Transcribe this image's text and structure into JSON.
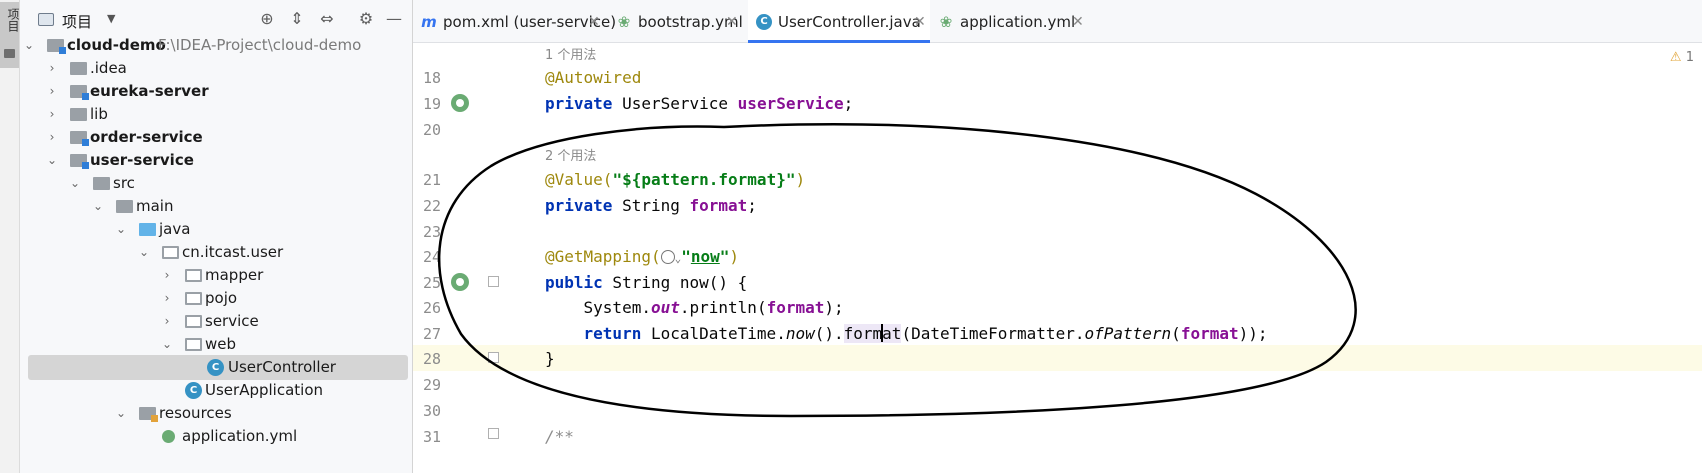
{
  "toolstrip": {
    "project_tab_label": "项目"
  },
  "project_panel": {
    "title": "项目",
    "tree": [
      {
        "label": "cloud-demo",
        "path": "F:\\IDEA-Project\\cloud-demo",
        "bold": true,
        "expanded": true,
        "icon": "module-folder-icon"
      },
      {
        "label": ".idea",
        "bold": false,
        "expanded": false,
        "icon": "folder-icon"
      },
      {
        "label": "eureka-server",
        "bold": true,
        "expanded": false,
        "icon": "module-folder-icon"
      },
      {
        "label": "lib",
        "bold": false,
        "expanded": false,
        "icon": "folder-icon"
      },
      {
        "label": "order-service",
        "bold": true,
        "expanded": false,
        "icon": "module-folder-icon"
      },
      {
        "label": "user-service",
        "bold": true,
        "expanded": true,
        "icon": "module-folder-icon"
      },
      {
        "label": "src",
        "bold": false,
        "expanded": true,
        "icon": "folder-icon"
      },
      {
        "label": "main",
        "bold": false,
        "expanded": true,
        "icon": "folder-icon"
      },
      {
        "label": "java",
        "bold": false,
        "expanded": true,
        "icon": "source-folder-icon"
      },
      {
        "label": "cn.itcast.user",
        "bold": false,
        "expanded": true,
        "icon": "package-icon"
      },
      {
        "label": "mapper",
        "bold": false,
        "expanded": false,
        "icon": "package-icon"
      },
      {
        "label": "pojo",
        "bold": false,
        "expanded": false,
        "icon": "package-icon"
      },
      {
        "label": "service",
        "bold": false,
        "expanded": false,
        "icon": "package-icon"
      },
      {
        "label": "web",
        "bold": false,
        "expanded": true,
        "icon": "package-icon"
      },
      {
        "label": "UserController",
        "bold": false,
        "selected": true,
        "icon": "java-class-icon"
      },
      {
        "label": "UserApplication",
        "bold": false,
        "icon": "spring-class-icon"
      },
      {
        "label": "resources",
        "bold": false,
        "expanded": true,
        "icon": "resources-folder-icon"
      },
      {
        "label": "application.yml",
        "bold": false,
        "icon": "yaml-file-icon"
      }
    ]
  },
  "tabs": [
    {
      "label": "pom.xml (user-service)",
      "icon": "maven-icon",
      "icon_glyph": "m",
      "active": false
    },
    {
      "label": "bootstrap.yml",
      "icon": "spring-yaml-icon",
      "icon_glyph": "❀",
      "active": false
    },
    {
      "label": "UserController.java",
      "icon": "java-class-icon",
      "icon_glyph": "C",
      "active": true
    },
    {
      "label": "application.yml",
      "icon": "spring-yaml-icon",
      "icon_glyph": "❀",
      "active": false
    }
  ],
  "editor": {
    "warning_count": "1",
    "usages_1": "1 个用法",
    "usages_2": "2 个用法",
    "lines": {
      "18": "18",
      "19": "19",
      "20": "20",
      "21": "21",
      "22": "22",
      "23": "23",
      "24": "24",
      "25": "25",
      "26": "26",
      "27": "27",
      "28": "28",
      "29": "29",
      "30": "30",
      "31": "31"
    },
    "code": {
      "l18_ann": "@Autowired",
      "l19_kw": "private",
      "l19_type": " UserService ",
      "l19_field": "userService",
      "l19_end": ";",
      "l21_ann": "@Value(",
      "l21_str": "\"${pattern.format}\"",
      "l21_end": ")",
      "l22_kw": "private",
      "l22_type": " String ",
      "l22_field": "format",
      "l22_end": ";",
      "l24_ann": "@GetMapping(",
      "l24_q1": "\"",
      "l24_str": "now",
      "l24_q2": "\"",
      "l24_end": ")",
      "l25_kw": "public",
      "l25_rest": " String now() {",
      "l26_a": "    System.",
      "l26_out": "out",
      "l26_b": ".println(",
      "l26_field": "format",
      "l26_end": ");",
      "l27_ind": "    ",
      "l27_kw": "return",
      "l27_a": " LocalDateTime.",
      "l27_now": "now",
      "l27_b": "().",
      "l27_fmt1": "form",
      "l27_fmt2": "at",
      "l27_c": "(DateTimeFormatter.",
      "l27_of": "ofPattern",
      "l27_d": "(",
      "l27_field": "format",
      "l27_end": "));",
      "l28": "}",
      "l31": "/**"
    }
  }
}
